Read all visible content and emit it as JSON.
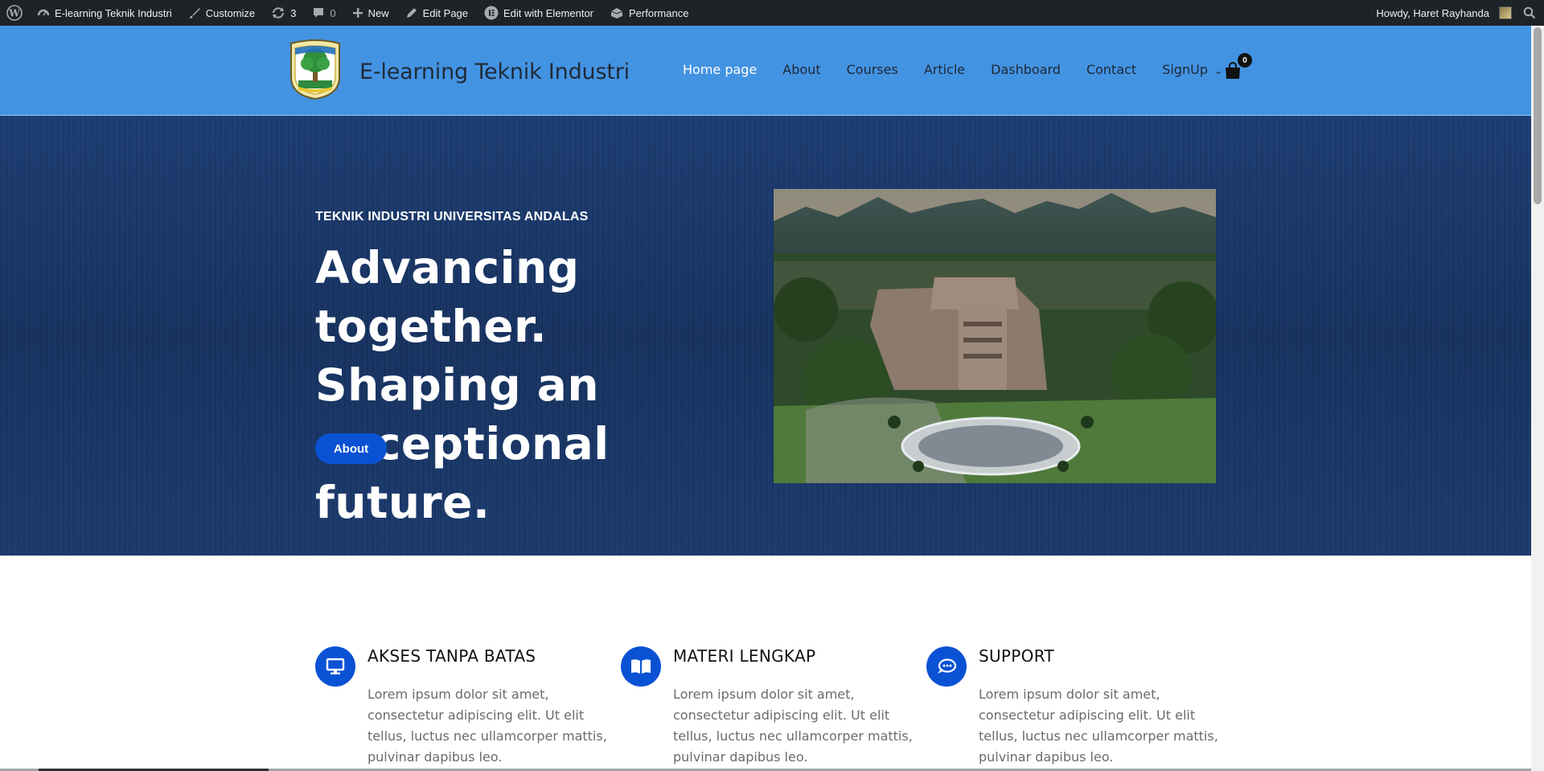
{
  "admin_bar": {
    "site_name": "E-learning Teknik Industri",
    "customize": "Customize",
    "updates_count": "3",
    "comments_count": "0",
    "new": "New",
    "edit_page": "Edit Page",
    "edit_elementor": "Edit with Elementor",
    "performance": "Performance",
    "howdy": "Howdy, Haret Rayhanda"
  },
  "header": {
    "site_title": "E-learning Teknik Industri",
    "nav": [
      "Home page",
      "About",
      "Courses",
      "Article",
      "Dashboard",
      "Contact",
      "SignUp"
    ],
    "cart_count": "0"
  },
  "hero": {
    "kicker": "TEKNIK INDUSTRI UNIVERSITAS ANDALAS",
    "headline": "Advancing together. Shaping an exceptional future.",
    "button": "About"
  },
  "features": [
    {
      "title": "AKSES TANPA BATAS",
      "icon": "monitor-icon",
      "text": "Lorem ipsum dolor sit amet, consectetur adipiscing elit. Ut elit tellus, luctus nec ullamcorper mattis, pulvinar dapibus leo."
    },
    {
      "title": "MATERI LENGKAP",
      "icon": "book-icon",
      "text": "Lorem ipsum dolor sit amet, consectetur adipiscing elit. Ut elit tellus, luctus nec ullamcorper mattis, pulvinar dapibus leo."
    },
    {
      "title": "SUPPORT",
      "icon": "chat-icon",
      "text": "Lorem ipsum dolor sit amet, consectetur adipiscing elit. Ut elit tellus, luctus nec ullamcorper mattis, pulvinar dapibus leo."
    }
  ],
  "colors": {
    "header": "#4393e3",
    "hero": "#173565",
    "accent": "#0a52d4",
    "admin_bar": "#1d2327"
  }
}
